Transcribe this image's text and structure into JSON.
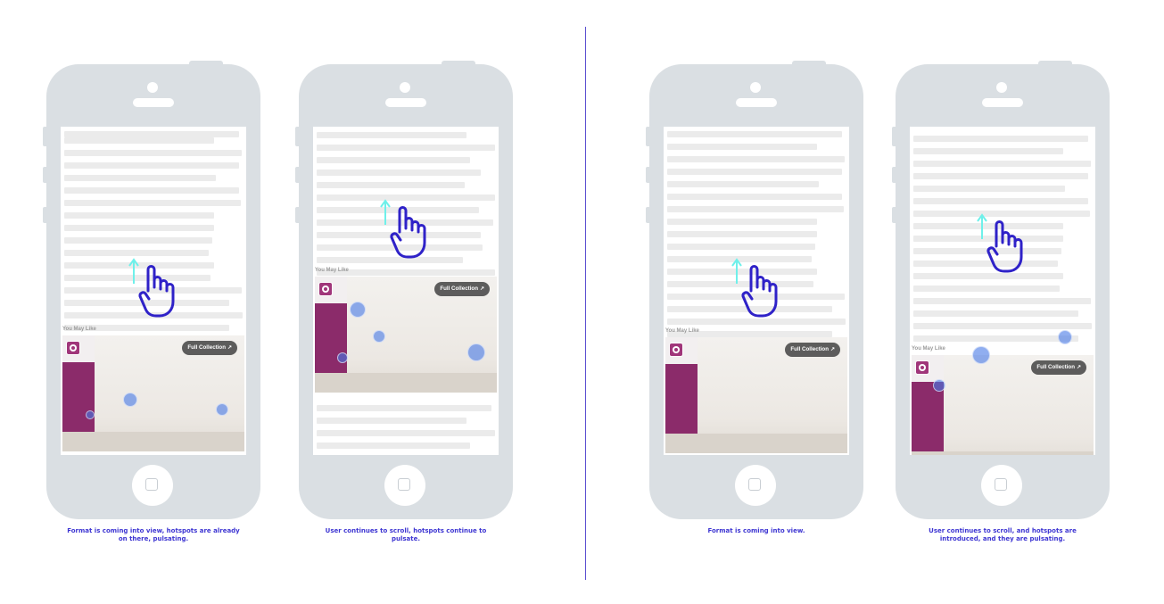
{
  "panels": [
    {
      "ad_label": "You May Like",
      "full_collection_label": "Full Collection",
      "caption": "Format is coming into view, hotspots are already on there, pulsating."
    },
    {
      "ad_label": "You May Like",
      "full_collection_label": "Full Collection",
      "caption": "User continues to scroll, hotspots continue to pulsate."
    },
    {
      "ad_label": "You May Like",
      "full_collection_label": "Full Collection",
      "caption": "Format is coming into view."
    },
    {
      "ad_label": "You May Like",
      "full_collection_label": "Full Collection",
      "caption": "User continues to scroll, and hotspots are introduced, and they are pulsating."
    }
  ],
  "colors": {
    "caption": "#3d35d2",
    "divider": "#5b4fd0",
    "phone": "#dadfe3",
    "hand": "#2f22c8",
    "arrow": "#6ff0ea",
    "hotspot": "#4678e6"
  },
  "icons": [
    "hand-pointer-icon",
    "scroll-up-arrow-icon",
    "external-link-icon",
    "home-button-icon"
  ]
}
